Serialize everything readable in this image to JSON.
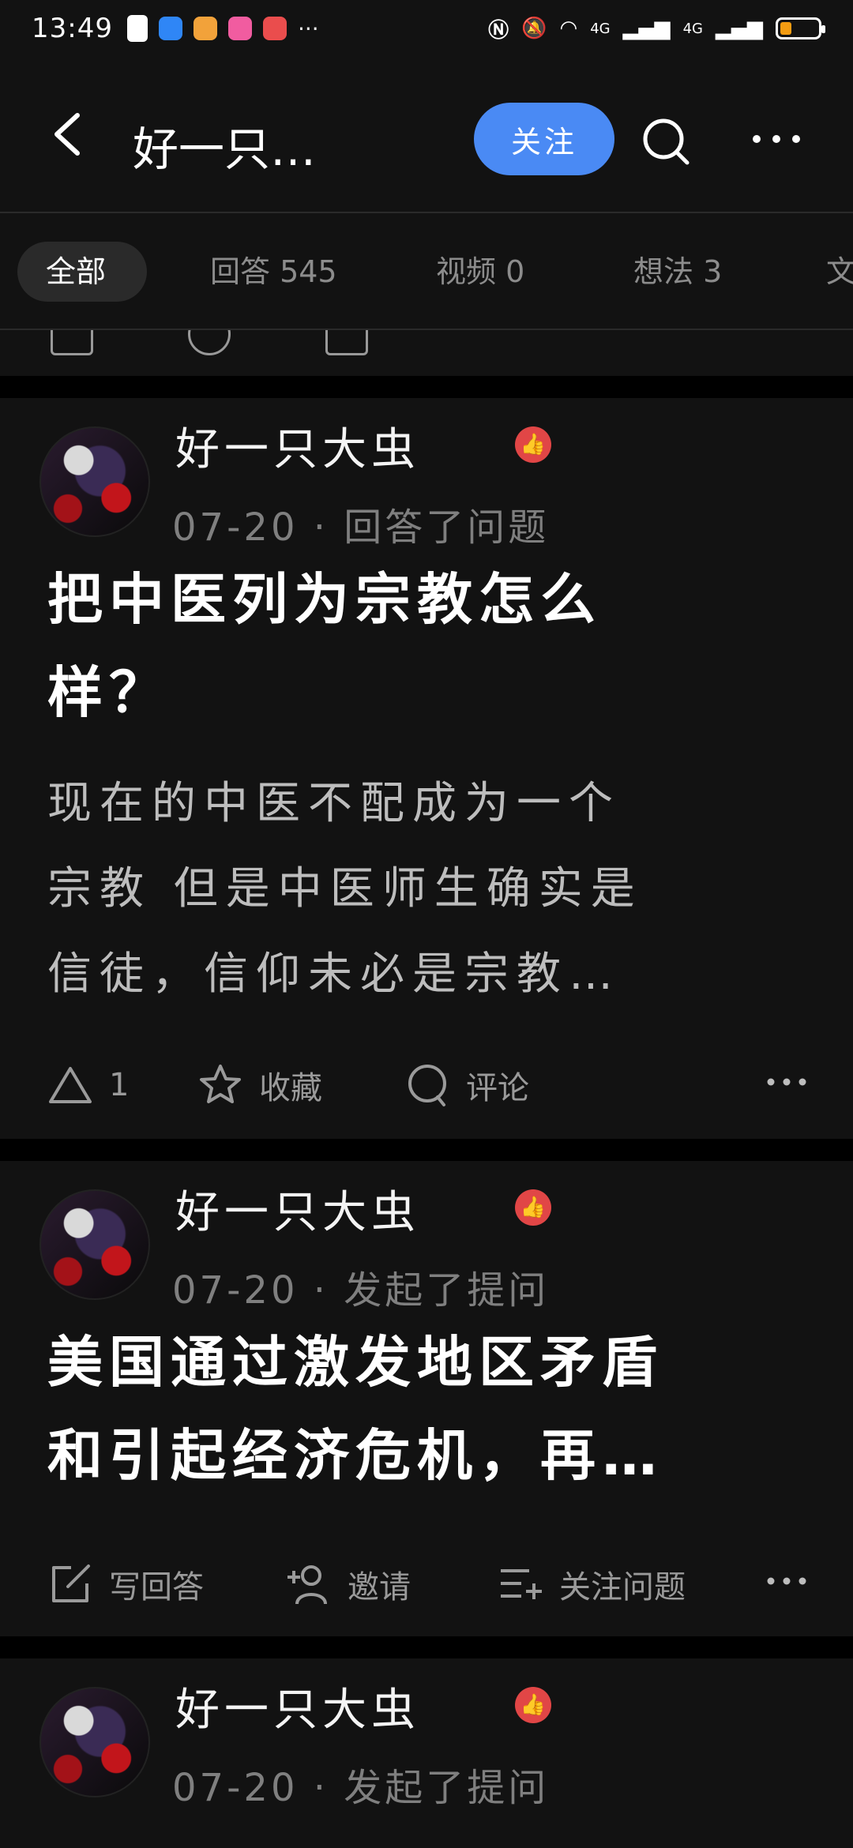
{
  "status": {
    "time": "13:49",
    "more": "···",
    "network_a": "4G",
    "network_b": "4G",
    "colors": {
      "app1": "#2f86f6",
      "app2": "#f2a23a",
      "app3": "#f15ca0",
      "app4": "#ea4d4d",
      "battery": "#f39c12"
    },
    "battery_level": 0.3
  },
  "header": {
    "title": "好一只…",
    "follow_label": "关注"
  },
  "tabs": [
    {
      "label": "全部"
    },
    {
      "label": "回答 545"
    },
    {
      "label": "视频 0"
    },
    {
      "label": "想法 3"
    },
    {
      "label": "文"
    }
  ],
  "cards": [
    {
      "author": "好一只大虫",
      "meta": "07-20 · 回答了问题",
      "title_line1": "把中医列为宗教怎么",
      "title_line2": "样？",
      "excerpt_line1": "现在的中医不配成为一个",
      "excerpt_line2": "宗教 但是中医师生确实是",
      "excerpt_line3": "信徒，信仰未必是宗教…",
      "actions": {
        "vote": "1",
        "collect": "收藏",
        "comment": "评论"
      }
    },
    {
      "author": "好一只大虫",
      "meta": "07-20 · 发起了提问",
      "title_line1": "美国通过激发地区矛盾",
      "title_line2": "和引起经济危机，再…",
      "actions": {
        "write": "写回答",
        "invite": "邀请",
        "follow_q": "关注问题"
      }
    },
    {
      "author": "好一只大虫",
      "meta": "07-20 · 发起了提问"
    }
  ],
  "accent_color": "#4a8af4",
  "badge_color": "#e14646"
}
